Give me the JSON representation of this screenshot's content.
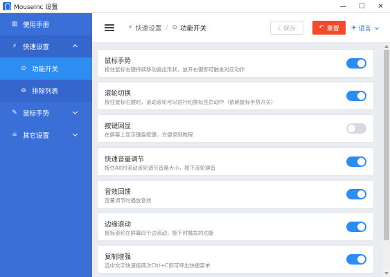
{
  "window": {
    "title": "MouseInc 设置"
  },
  "window_controls": {
    "minimize": "—",
    "maximize": "☐",
    "close": "✕"
  },
  "sidebar": {
    "items": [
      {
        "label": "使用手册",
        "icon": "book-icon",
        "glyph": "▥"
      },
      {
        "label": "快速设置",
        "icon": "flash-icon",
        "glyph": "⚡",
        "expanded": true
      },
      {
        "label": "功能开关",
        "icon": "toggle-icon",
        "glyph": "⊙",
        "active": true
      },
      {
        "label": "排除列表",
        "icon": "minus-circle-icon",
        "glyph": "⊖"
      },
      {
        "label": "鼠标手势",
        "icon": "tools-icon",
        "glyph": "✎"
      },
      {
        "label": "其它设置",
        "icon": "sliders-icon",
        "glyph": "≑"
      }
    ]
  },
  "header": {
    "breadcrumb": {
      "parent": "快速设置",
      "separator": "/",
      "current": "功能开关"
    },
    "save_label": "保存",
    "save_glyph": "⤓",
    "reset_label": "重置",
    "reset_glyph": "↶",
    "lang_label": "语言",
    "lang_glyph": "✈"
  },
  "settings": [
    {
      "title": "鼠标手势",
      "desc": "按住鼠标右键持续移动画出形状，放开右键即可触发对应动作",
      "on": true
    },
    {
      "title": "滚轮切换",
      "desc": "按住鼠标右键时，滚动滚轮可以进行切换标签页动作（依赖鼠标手势开关）",
      "on": true
    },
    {
      "title": "按键回显",
      "desc": "在屏幕上显示键盘按键，方便录制教程",
      "on": false
    },
    {
      "title": "快速音量调节",
      "desc": "按住Alt时滚动滚轮调节音量大小，按下滚轮静音",
      "on": true
    },
    {
      "title": "音效回馈",
      "desc": "音量调节时播放音效",
      "on": true
    },
    {
      "title": "边缘滚动",
      "desc": "鼠标滚轮在屏幕四个边滚动，按下时触发的功能",
      "on": true
    },
    {
      "title": "复制增强",
      "desc": "选中文字快速按两次Ctrl+C即可呼出快捷菜单",
      "on": true
    }
  ],
  "colors": {
    "sidebar": "#3a6fd8",
    "active": "#2f8cf0",
    "toggle_on": "#2d8cf0",
    "reset": "#f24a2a"
  }
}
